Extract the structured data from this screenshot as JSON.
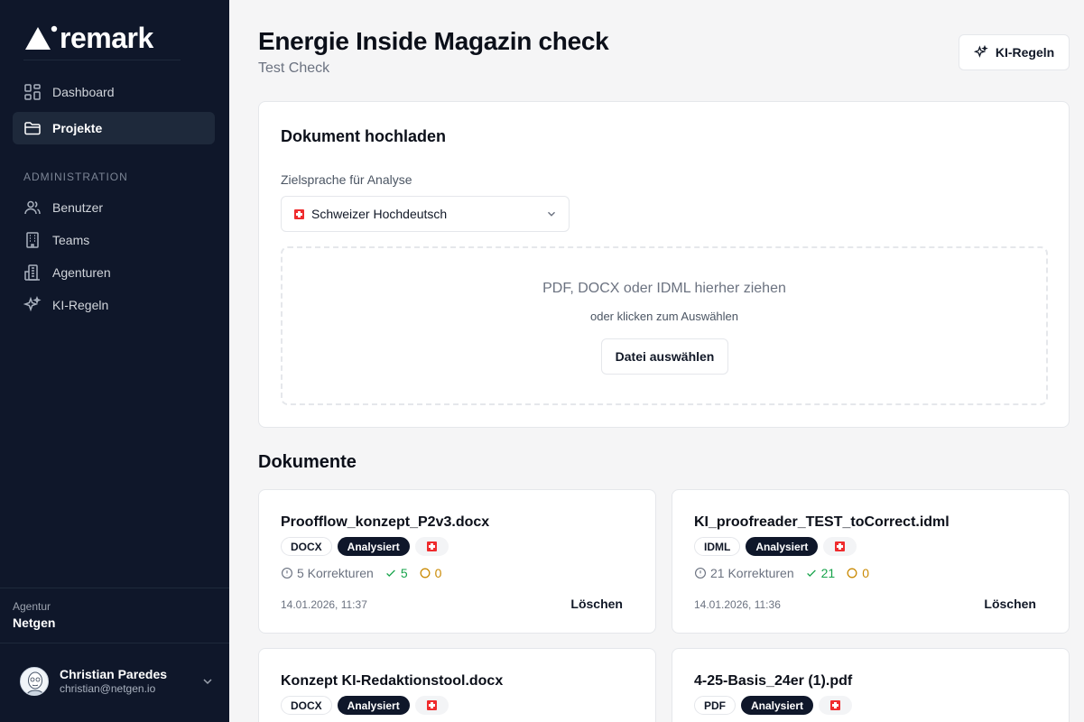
{
  "brand": {
    "name": "remark"
  },
  "sidebar": {
    "items": [
      {
        "label": "Dashboard",
        "icon": "dashboard-icon"
      },
      {
        "label": "Projekte",
        "icon": "folder-icon",
        "active": true
      }
    ],
    "admin_section": "ADMINISTRATION",
    "admin_items": [
      {
        "label": "Benutzer",
        "icon": "users-icon"
      },
      {
        "label": "Teams",
        "icon": "building-icon"
      },
      {
        "label": "Agenturen",
        "icon": "office-icon"
      },
      {
        "label": "KI-Regeln",
        "icon": "sparkles-icon"
      }
    ],
    "agency_label": "Agentur",
    "agency_name": "Netgen",
    "user": {
      "name": "Christian Paredes",
      "email": "christian@netgen.io"
    }
  },
  "header": {
    "title": "Energie Inside Magazin check",
    "subtitle": "Test Check",
    "ki_button": "KI-Regeln"
  },
  "upload": {
    "title": "Dokument hochladen",
    "language_label": "Zielsprache für Analyse",
    "language_value": "Schweizer Hochdeutsch",
    "drop_main": "PDF, DOCX oder IDML hierher ziehen",
    "drop_sub": "oder klicken zum Auswählen",
    "choose_button": "Datei auswählen"
  },
  "documents": {
    "title": "Dokumente",
    "delete_label": "Löschen",
    "items": [
      {
        "name": "Proofflow_konzept_P2v3.docx",
        "type": "DOCX",
        "status": "Analysiert",
        "corrections": "5 Korrekturen",
        "accepted": "5",
        "open": "0",
        "date": "14.01.2026, 11:37"
      },
      {
        "name": "KI_proofreader_TEST_toCorrect.idml",
        "type": "IDML",
        "status": "Analysiert",
        "corrections": "21 Korrekturen",
        "accepted": "21",
        "open": "0",
        "date": "14.01.2026, 11:36"
      },
      {
        "name": "Konzept KI-Redaktionstool.docx",
        "type": "DOCX",
        "status": "Analysiert"
      },
      {
        "name": "4-25-Basis_24er (1).pdf",
        "type": "PDF",
        "status": "Analysiert"
      }
    ]
  },
  "colors": {
    "sidebar_bg": "#0f172a",
    "accent_green": "#16a34a",
    "accent_amber": "#ca8a04"
  }
}
